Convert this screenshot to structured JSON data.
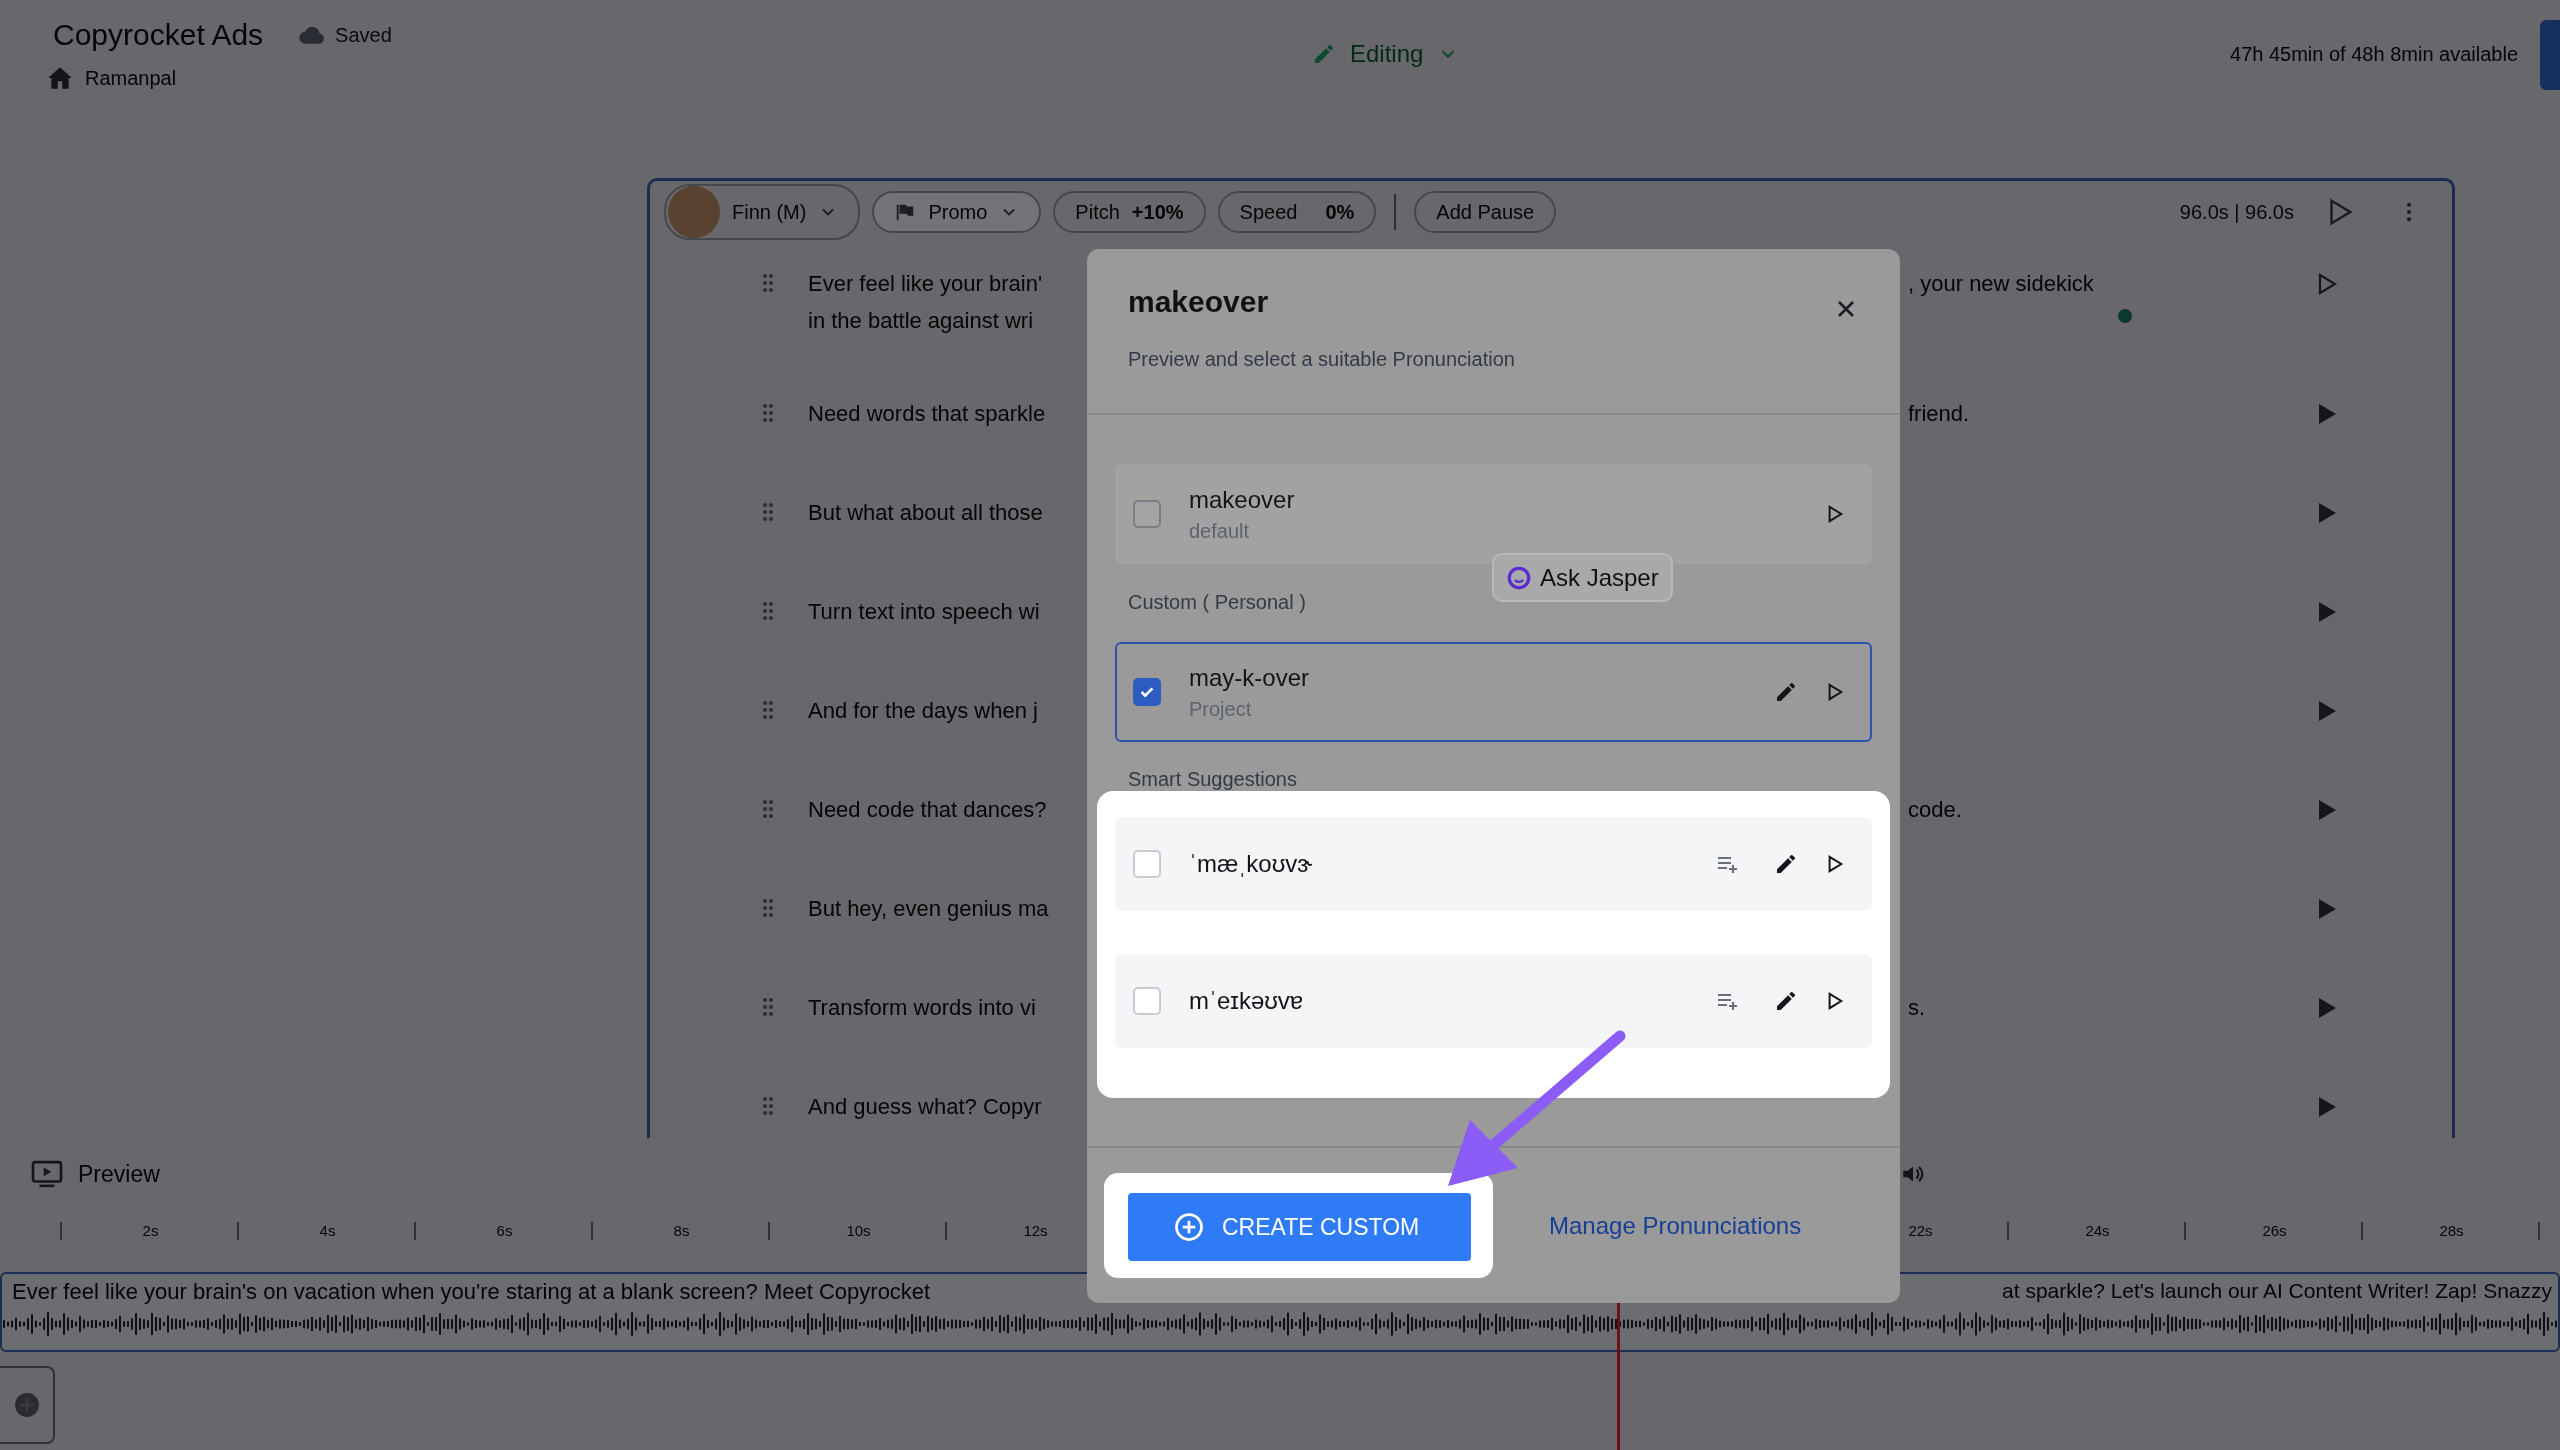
{
  "header": {
    "title": "Copyrocket Ads",
    "save_status": "Saved",
    "breadcrumb": "Ramanpal",
    "mode": "Editing",
    "usage": "47h 45min of 48h 8min available"
  },
  "editor": {
    "voice": "Finn (M)",
    "style": "Promo",
    "pitch_label": "Pitch",
    "pitch_value": "+10%",
    "speed_label": "Speed",
    "speed_value": "0%",
    "add_pause": "Add Pause",
    "duration": "96.0s | 96.0s",
    "paragraphs": [
      {
        "left_lines": [
          "Ever feel like your brain'",
          "in the battle against wri"
        ],
        "right": ", your new sidekick",
        "active": true
      },
      {
        "left_lines": [
          "Need words that sparkle"
        ],
        "right": "friend.",
        "active": false
      },
      {
        "left_lines": [
          "But what about all those"
        ],
        "active": false
      },
      {
        "left_lines": [
          "Turn text into speech wi"
        ],
        "active": false
      },
      {
        "left_lines": [
          "And for the days when j"
        ],
        "active": false
      },
      {
        "left_lines": [
          "Need code that dances?"
        ],
        "right": "code.",
        "active": false
      },
      {
        "left_lines": [
          "But hey, even genius ma"
        ],
        "active": false
      },
      {
        "left_lines": [
          "Transform words into vi"
        ],
        "right": "s.",
        "active": false
      },
      {
        "left_lines": [
          "And guess what? Copyr"
        ],
        "active": false
      }
    ]
  },
  "preview_bar": {
    "preview": "Preview"
  },
  "timeline": {
    "ticks_before": [
      "2s",
      "4s",
      "6s",
      "8s",
      "10s",
      "12s"
    ],
    "ticks_after": [
      "22s",
      "24s",
      "26s",
      "28s"
    ],
    "track_text_start": "Ever feel like your brain's on vacation when you're staring at a blank screen? Meet Copyrocket",
    "track_text_end": "at sparkle? Let's launch our AI Content Writer! Zap! Snazzy"
  },
  "dialog": {
    "title": "makeover",
    "subtitle": "Preview and select a suitable Pronunciation",
    "default_option": {
      "label": "makeover",
      "sublabel": "default",
      "checked": false
    },
    "tooltip": "Ask Jasper",
    "custom_heading": "Custom ( Personal )",
    "custom_options": [
      {
        "label": "may-k-over",
        "sublabel": "Project",
        "checked": true
      }
    ],
    "suggestions_heading": "Smart Suggestions",
    "suggestions": [
      {
        "label": "ˈmæˌkoʊvɝ",
        "checked": false
      },
      {
        "label": "mˈeɪkəʊvɐ",
        "checked": false
      }
    ],
    "create_button": "CREATE CUSTOM",
    "manage_link": "Manage Pronunciations"
  }
}
